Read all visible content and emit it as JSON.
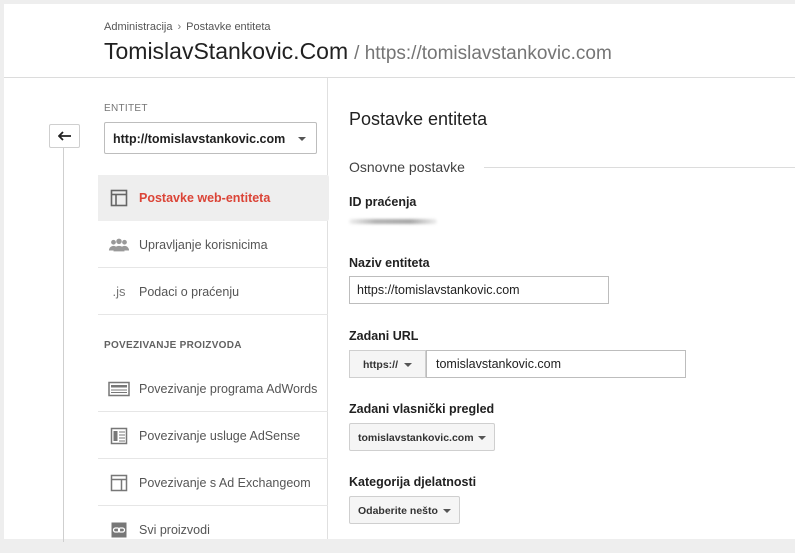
{
  "header": {
    "breadcrumb": [
      "Administracija",
      "Postavke entiteta"
    ],
    "breadcrumb_sep": "›",
    "title": "TomislavStankovic.Com",
    "subtitle": "/ https://tomislavstankovic.com"
  },
  "sidebar": {
    "back_icon": "back-arrow-icon",
    "entity_label": "ENTITET",
    "entity_selected": "http://tomislavstankovic.com",
    "items": [
      {
        "label": "Postavke web-entiteta",
        "icon": "layout-icon",
        "active": true
      },
      {
        "label": "Upravljanje korisnicima",
        "icon": "users-icon",
        "active": false
      },
      {
        "label": "Podaci o praćenju",
        "icon": "js-icon",
        "icon_text": ".js",
        "active": false
      }
    ],
    "section_label": "POVEZIVANJE PROIZVODA",
    "product_items": [
      {
        "label": "Povezivanje programa AdWords",
        "icon": "adwords-icon"
      },
      {
        "label": "Povezivanje usluge AdSense",
        "icon": "adsense-icon"
      },
      {
        "label": "Povezivanje s Ad Exchangeom",
        "icon": "ad-exchange-icon"
      },
      {
        "label": "Svi proizvodi",
        "icon": "link-icon"
      }
    ]
  },
  "main": {
    "title": "Postavke entiteta",
    "section_title": "Osnovne postavke",
    "tracking_id_label": "ID praćenja",
    "property_name_label": "Naziv entiteta",
    "property_name_value": "https://tomislavstankovic.com",
    "default_url_label": "Zadani URL",
    "protocol": "https://",
    "default_url_value": "tomislavstankovic.com",
    "default_view_label": "Zadani vlasnički pregled",
    "default_view_value": "tomislavstankovic.com",
    "industry_label": "Kategorija djelatnosti",
    "industry_value": "Odaberite nešto"
  },
  "colors": {
    "active_accent": "#db4437",
    "active_bg": "#eeeeee",
    "page_bg": "#eeeeee"
  }
}
